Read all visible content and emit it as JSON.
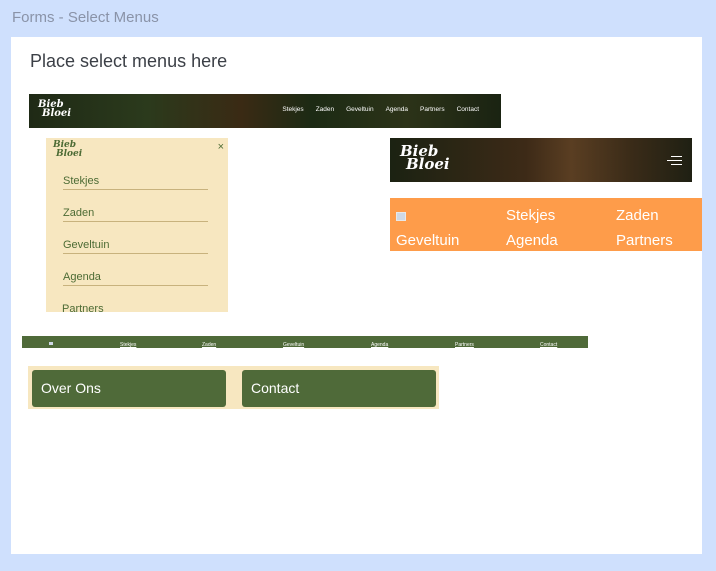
{
  "frame": {
    "title": "Forms - Select Menus"
  },
  "canvas": {
    "heading": "Place select menus here"
  },
  "header_desktop": {
    "logo_line1": "Bieb",
    "logo_line2": "Bloei",
    "nav": [
      "Stekjes",
      "Zaden",
      "Geveltuin",
      "Agenda",
      "Partners",
      "Contact"
    ]
  },
  "mobile_menu": {
    "logo_line1": "Bieb",
    "logo_line2": "Bloei",
    "close_symbol": "×",
    "items": [
      "Stekjes",
      "Zaden",
      "Geveltuin",
      "Agenda",
      "Partners"
    ]
  },
  "header_mobile": {
    "logo_line1": "Bieb",
    "logo_line2": "Bloei"
  },
  "orange_nav": {
    "items": [
      "Stekjes",
      "Zaden",
      "Geveltuin",
      "Agenda",
      "Partners"
    ]
  },
  "thin_nav": {
    "items": [
      "Stekjes",
      "Zaden",
      "Geveltuin",
      "Agenda",
      "Partners",
      "Contact"
    ]
  },
  "buttons": {
    "over_ons": "Over Ons",
    "contact": "Contact"
  },
  "colors": {
    "background": "#cfe0fd",
    "brand_green": "#4f6a39",
    "cream": "#f7e7c0",
    "orange": "#fe9c4a"
  }
}
